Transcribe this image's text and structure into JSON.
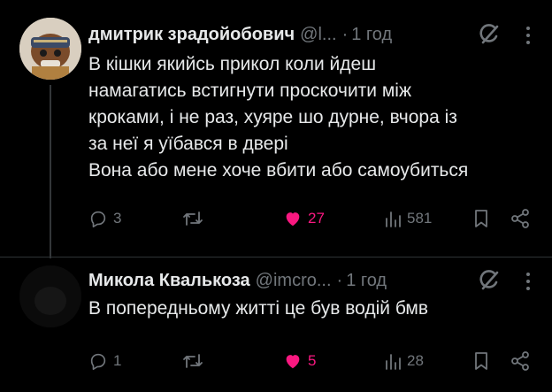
{
  "tweets": [
    {
      "name": "дмитрик зрадойобович",
      "handle": "@l...",
      "separator": "·",
      "time": "1 год",
      "lines": [
        "В кішки якийсь прикол коли йдеш",
        "намагатись встигнути проскочити між",
        "кроками, і не раз, хуяре шо дурне, вчора із",
        "за неї я уїбався в двері",
        "Вона або мене хоче вбити або самоубиться"
      ],
      "replies": "3",
      "likes": "27",
      "views": "581",
      "liked": true
    },
    {
      "name": "Микола Квалькоза",
      "handle": "@imcro...",
      "separator": "·",
      "time": "1 год",
      "lines": [
        "В попередньому житті це був водій бмв"
      ],
      "replies": "1",
      "likes": "5",
      "views": "28",
      "liked": true
    }
  ],
  "colors": {
    "background": "#000000",
    "text": "#e7e9ea",
    "secondary": "#71767b",
    "like": "#f91880",
    "divider": "#2f3336"
  },
  "icons": [
    "grok-icon",
    "more-icon",
    "reply-icon",
    "repost-icon",
    "heart-icon",
    "views-icon",
    "bookmark-icon",
    "share-icon"
  ]
}
